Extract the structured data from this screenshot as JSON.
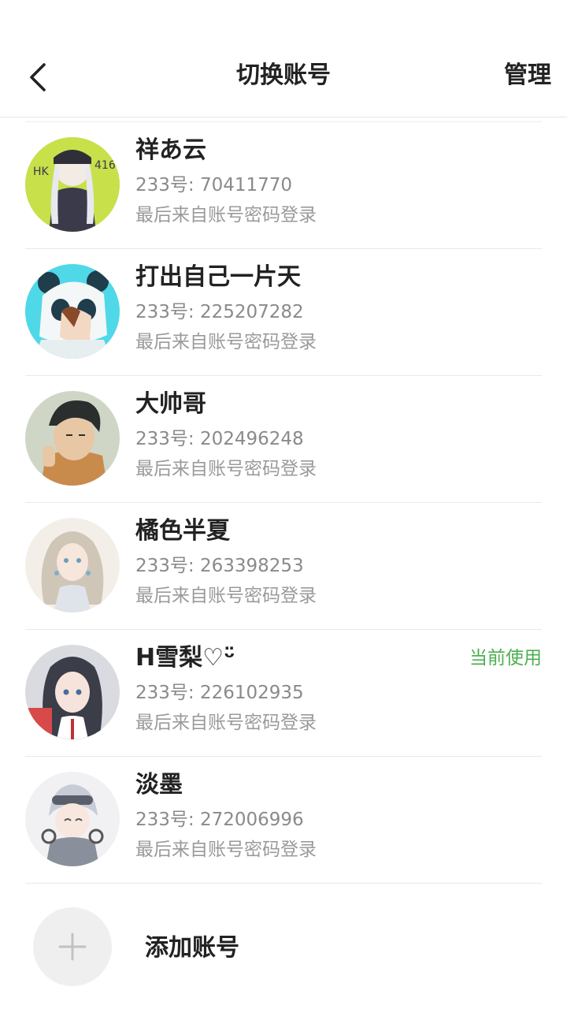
{
  "header": {
    "title": "切换账号",
    "manage_label": "管理",
    "back_icon": "chevron-left-icon"
  },
  "accounts": [
    {
      "name": "祥あ云",
      "id_label": "233号:",
      "id": "70411770",
      "source": "最后来自账号密码登录",
      "current_label": "",
      "avatar_colors": [
        "#c8e04a",
        "#3a3a4a"
      ]
    },
    {
      "name": "打出自己一片天",
      "id_label": "233号:",
      "id": "225207282",
      "source": "最后来自账号密码登录",
      "current_label": "",
      "avatar_colors": [
        "#4fd8e8",
        "#f2f2f2"
      ]
    },
    {
      "name": "大帅哥",
      "id_label": "233号:",
      "id": "202496248",
      "source": "最后来自账号密码登录",
      "current_label": "",
      "avatar_colors": [
        "#e8d2b8",
        "#2a2f2e"
      ]
    },
    {
      "name": "橘色半夏",
      "id_label": "233号:",
      "id": "263398253",
      "source": "最后来自账号密码登录",
      "current_label": "",
      "avatar_colors": [
        "#f3efe8",
        "#cfc6b8"
      ]
    },
    {
      "name": "H雪梨♡ᵕ̈",
      "id_label": "233号:",
      "id": "226102935",
      "source": "最后来自账号密码登录",
      "current_label": "当前使用",
      "avatar_colors": [
        "#d9dbe0",
        "#3b3d48"
      ]
    },
    {
      "name": "淡墨",
      "id_label": "233号:",
      "id": "272006996",
      "source": "最后来自账号密码登录",
      "current_label": "",
      "avatar_colors": [
        "#f1f1f4",
        "#8a8f9c"
      ]
    }
  ],
  "add_account": {
    "label": "添加账号",
    "icon": "plus-icon"
  },
  "colors": {
    "accent_current": "#4caf50",
    "divider": "#e9e9e9",
    "text_primary": "#222222",
    "text_secondary": "#8a8a8a"
  }
}
